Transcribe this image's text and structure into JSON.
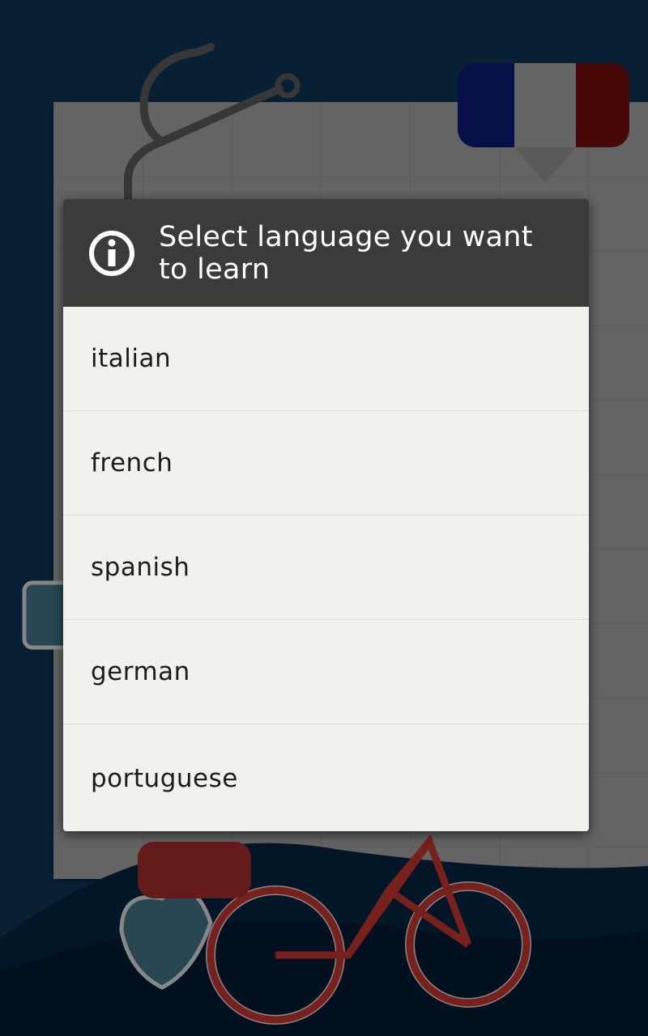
{
  "dialog": {
    "title": "Select language you want to learn",
    "icon": "info-icon",
    "options": [
      "italian",
      "french",
      "spanish",
      "german",
      "portuguese"
    ]
  },
  "background": {
    "flag_icon": "french-flag-icon",
    "colors": {
      "page_bg": "#0d3250",
      "flag_blue": "#0a1a6e",
      "flag_white": "#9c9c9c",
      "flag_red": "#6e0d0d"
    }
  }
}
